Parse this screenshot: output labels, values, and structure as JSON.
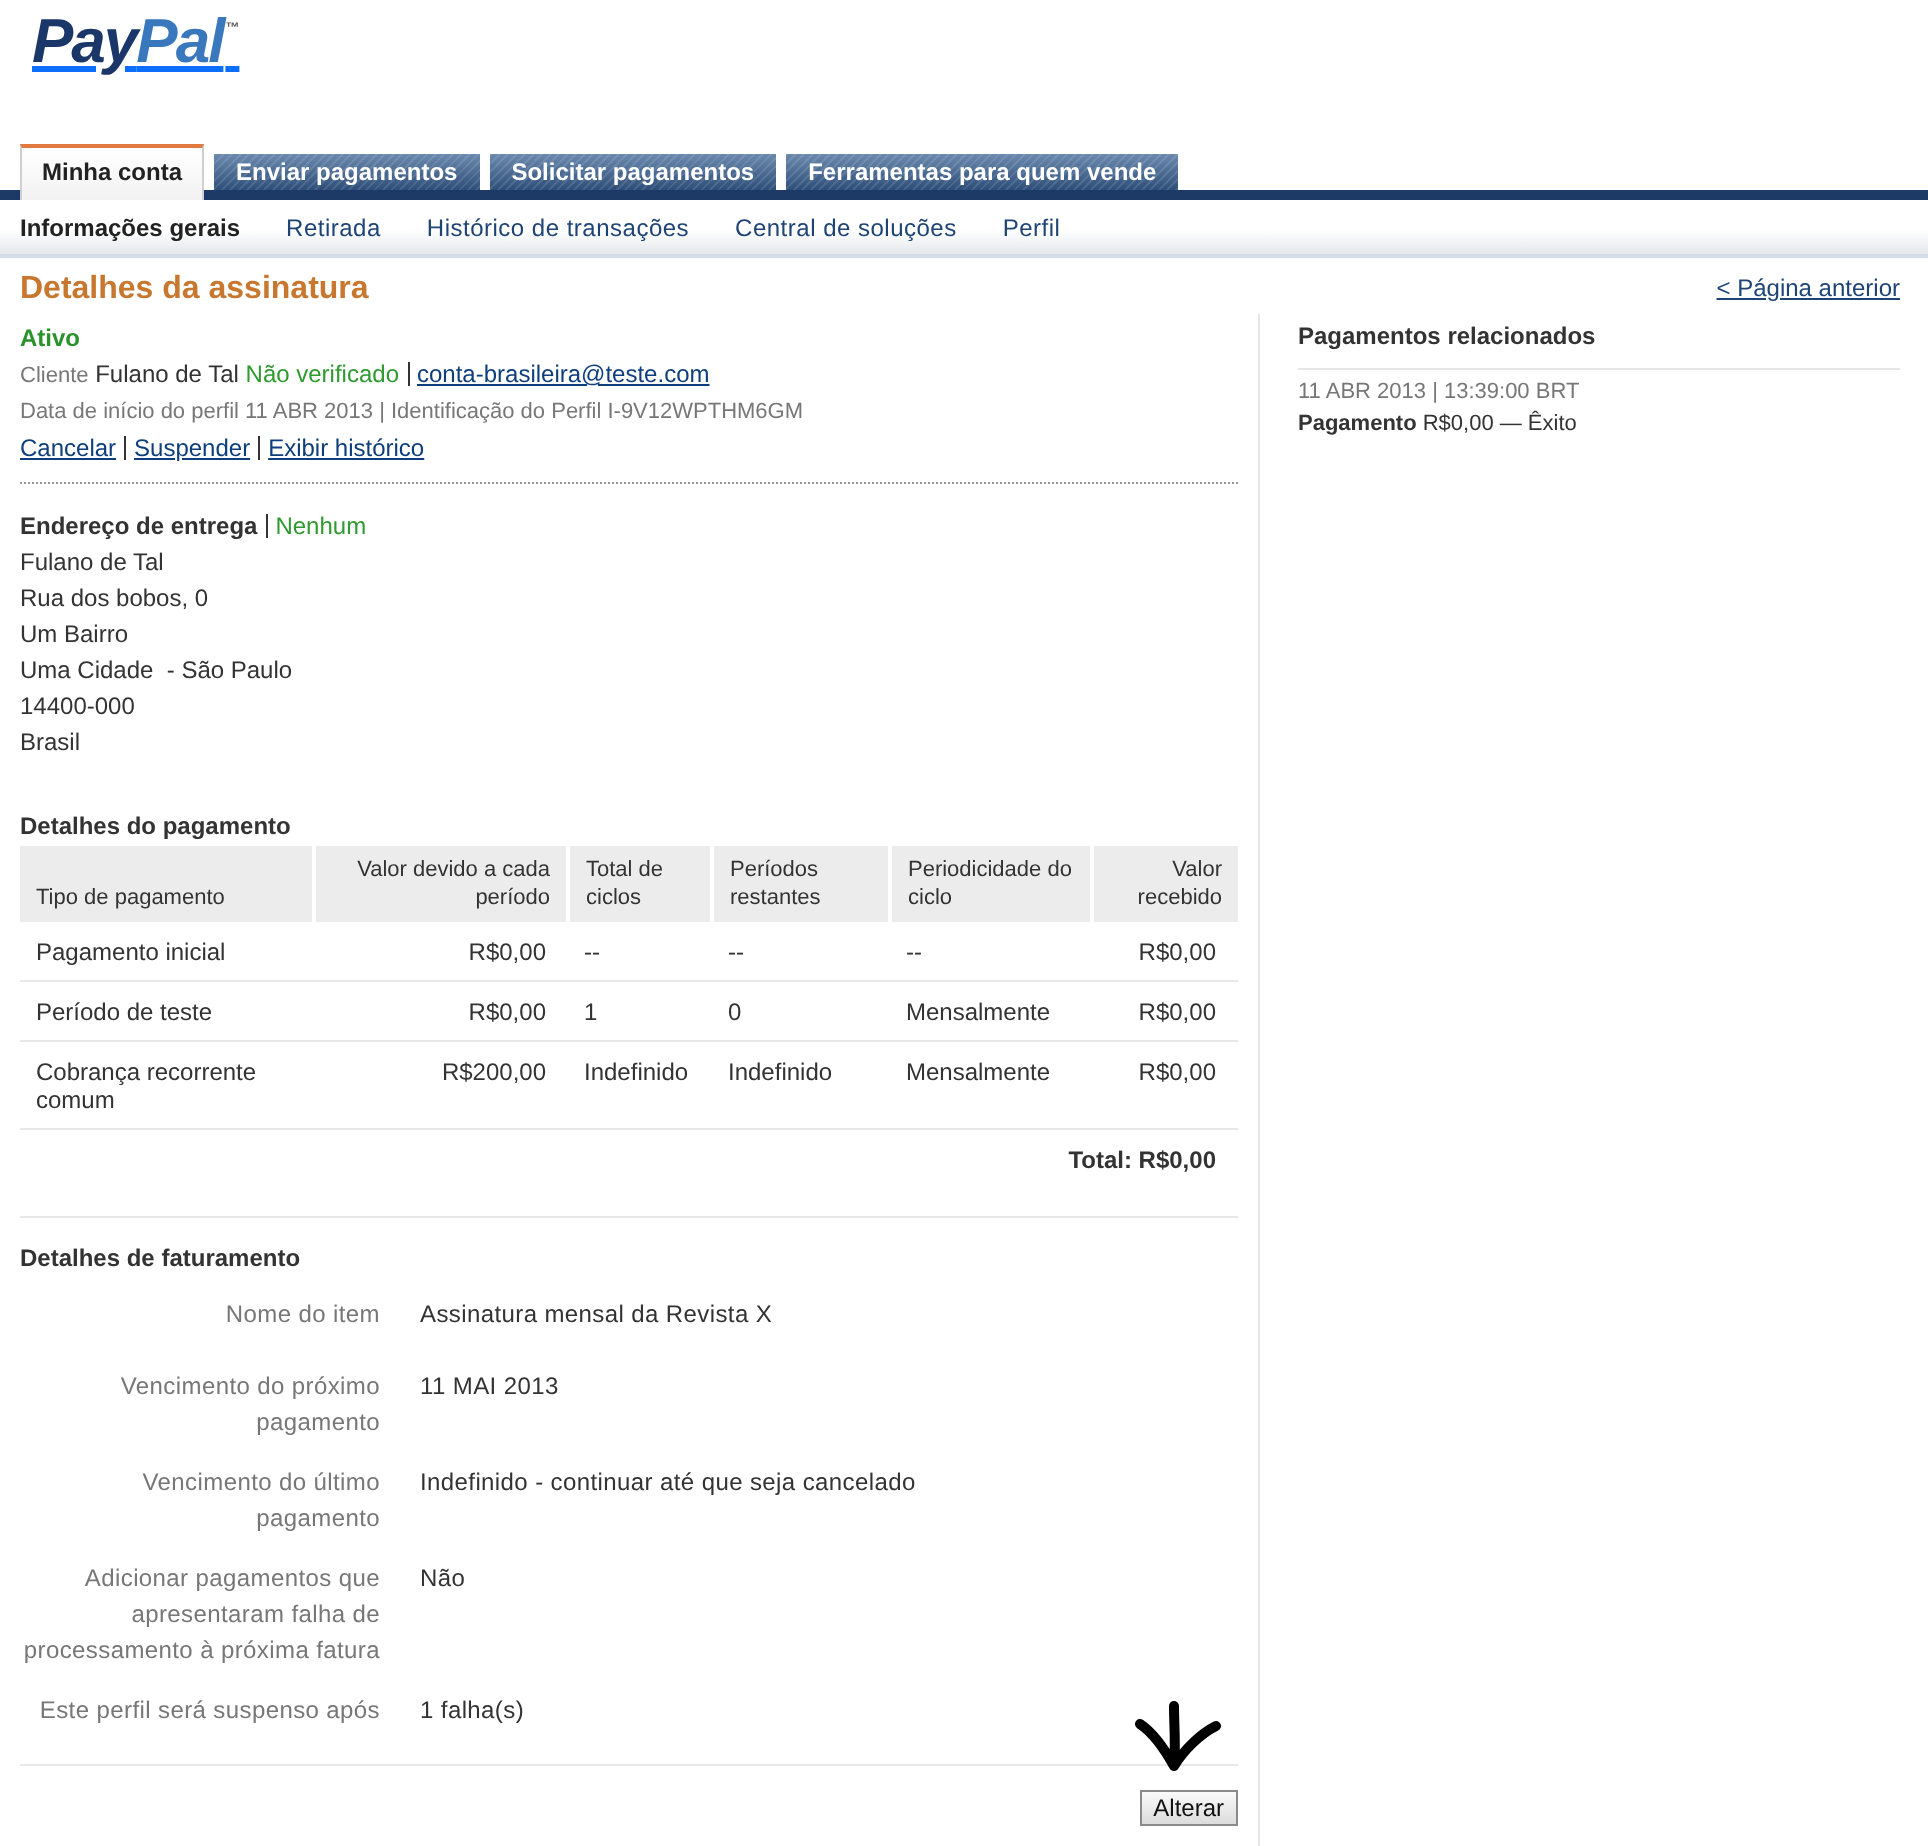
{
  "logo": {
    "parts": [
      "Pay",
      "Pal"
    ],
    "mark": "™"
  },
  "tabs": [
    {
      "label": "Minha conta",
      "selected": true
    },
    {
      "label": "Enviar pagamentos",
      "selected": false
    },
    {
      "label": "Solicitar pagamentos",
      "selected": false
    },
    {
      "label": "Ferramentas para quem vende",
      "selected": false
    }
  ],
  "subnav": [
    {
      "label": "Informações gerais",
      "selected": true
    },
    {
      "label": "Retirada",
      "selected": false
    },
    {
      "label": "Histórico de transações",
      "selected": false
    },
    {
      "label": "Central de soluções",
      "selected": false
    },
    {
      "label": "Perfil",
      "selected": false
    }
  ],
  "page": {
    "title": "Detalhes da assinatura",
    "back_link": "< Página anterior"
  },
  "subscription": {
    "status": "Ativo",
    "customer_label": "Cliente",
    "customer_name": "Fulano de Tal",
    "verification": "Não verificado",
    "email": "conta-brasileira@teste.com",
    "profile_info": "Data de início do perfil 11 ABR 2013 | Identificação do Perfil I-9V12WPTHM6GM",
    "actions": [
      "Cancelar",
      "Suspender",
      "Exibir histórico"
    ]
  },
  "shipping": {
    "label": "Endereço de entrega",
    "value": "Nenhum",
    "address": [
      "Fulano de Tal",
      "Rua dos bobos, 0",
      "Um Bairro",
      "Uma Cidade  - São Paulo",
      "14400-000",
      "Brasil"
    ]
  },
  "payment_details": {
    "title": "Detalhes do pagamento",
    "columns": [
      "Tipo de pagamento",
      "Valor devido a cada período",
      "Total de ciclos",
      "Períodos restantes",
      "Periodicidade do ciclo",
      "Valor recebido"
    ],
    "rows": [
      [
        "Pagamento inicial",
        "R$0,00",
        "--",
        "--",
        "--",
        "R$0,00"
      ],
      [
        "Período de teste",
        "R$0,00",
        "1",
        "0",
        "Mensalmente",
        "R$0,00"
      ],
      [
        "Cobrança recorrente comum",
        "R$200,00",
        "Indefinido",
        "Indefinido",
        "Mensalmente",
        "R$0,00"
      ]
    ],
    "total": "Total: R$0,00"
  },
  "billing_details": {
    "title": "Detalhes de faturamento",
    "rows": [
      {
        "label": "Nome do item",
        "value": "Assinatura mensal da Revista X"
      },
      {
        "label": "Vencimento do próximo pagamento",
        "value": "11 MAI 2013"
      },
      {
        "label": "Vencimento do último pagamento",
        "value": "Indefinido - continuar até que seja cancelado"
      },
      {
        "label": "Adicionar pagamentos que apresentaram falha de processamento à próxima fatura",
        "value": "Não"
      },
      {
        "label": "Este perfil será suspenso após",
        "value": "1 falha(s)"
      }
    ],
    "button": "Alterar"
  },
  "related_payments": {
    "title": "Pagamentos relacionados",
    "items": [
      {
        "date": "11 ABR 2013 | 13:39:00 BRT",
        "summary": "**Pagamento** R$0,00 — Êxito"
      }
    ]
  }
}
